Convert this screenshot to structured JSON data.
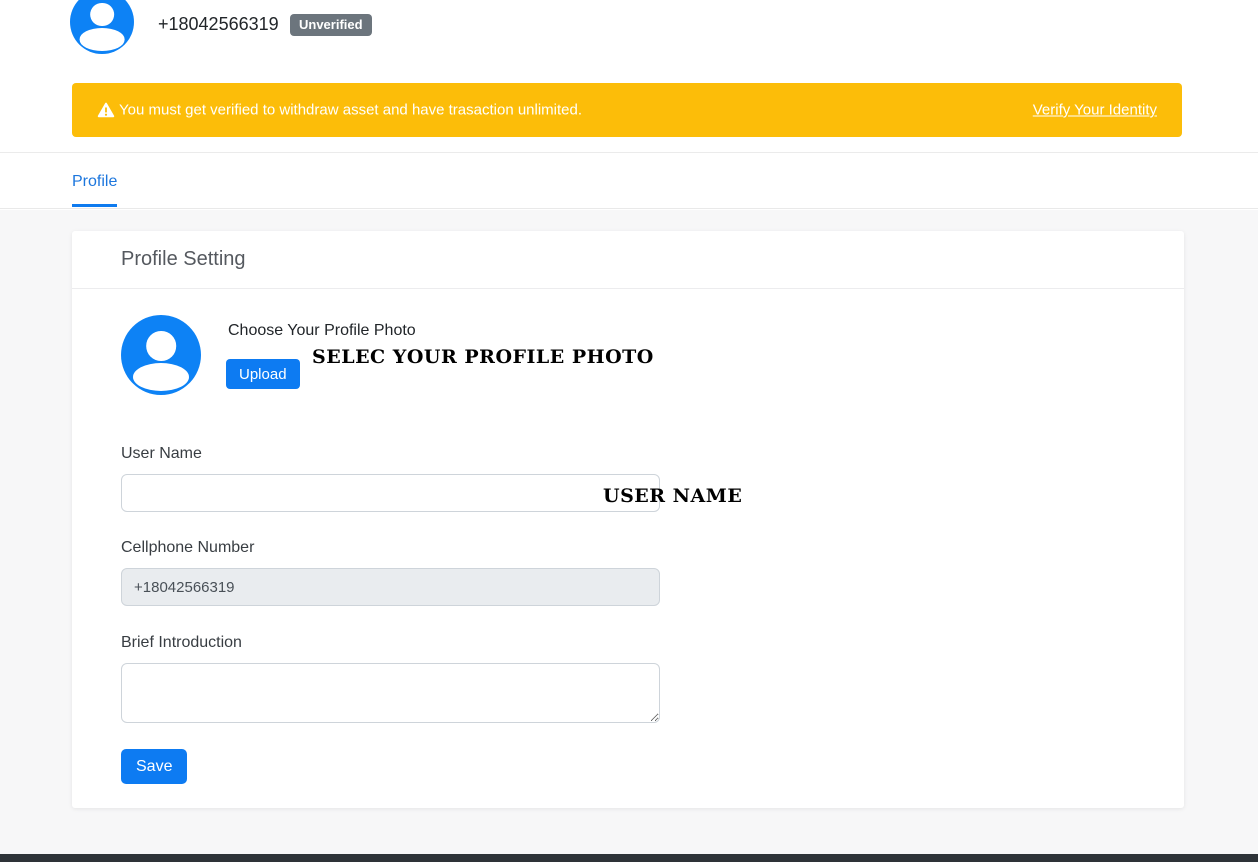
{
  "header": {
    "phone": "+18042566319",
    "badge": "Unverified"
  },
  "banner": {
    "message": "You must get verified to withdraw asset and have trasaction unlimited.",
    "link_label": "Verify Your Identity"
  },
  "tabs": [
    {
      "label": "Profile",
      "active": true
    }
  ],
  "card": {
    "title": "Profile Setting",
    "photo_section": {
      "label": "Choose Your Profile Photo",
      "upload_button": "Upload",
      "annotation": "SELEC YOUR PROFILE PHOTO"
    },
    "fields": {
      "username": {
        "label": "User Name",
        "value": "",
        "annotation": "USER NAME"
      },
      "cellphone": {
        "label": "Cellphone Number",
        "value": "+18042566319",
        "state": "disabled"
      },
      "intro": {
        "label": "Brief Introduction",
        "value": ""
      }
    },
    "save_button": "Save"
  },
  "icons": {
    "avatar": "user-avatar-icon",
    "warning": "warning-triangle-icon"
  },
  "colors": {
    "primary_blue": "#0d7bf2",
    "avatar_blue": "#0d82f5",
    "banner_yellow": "#fcbd09",
    "badge_gray": "#6c757d",
    "tab_blue": "#1c76dd",
    "page_gray": "#f7f7f8",
    "footer_dark": "#2e3338"
  }
}
